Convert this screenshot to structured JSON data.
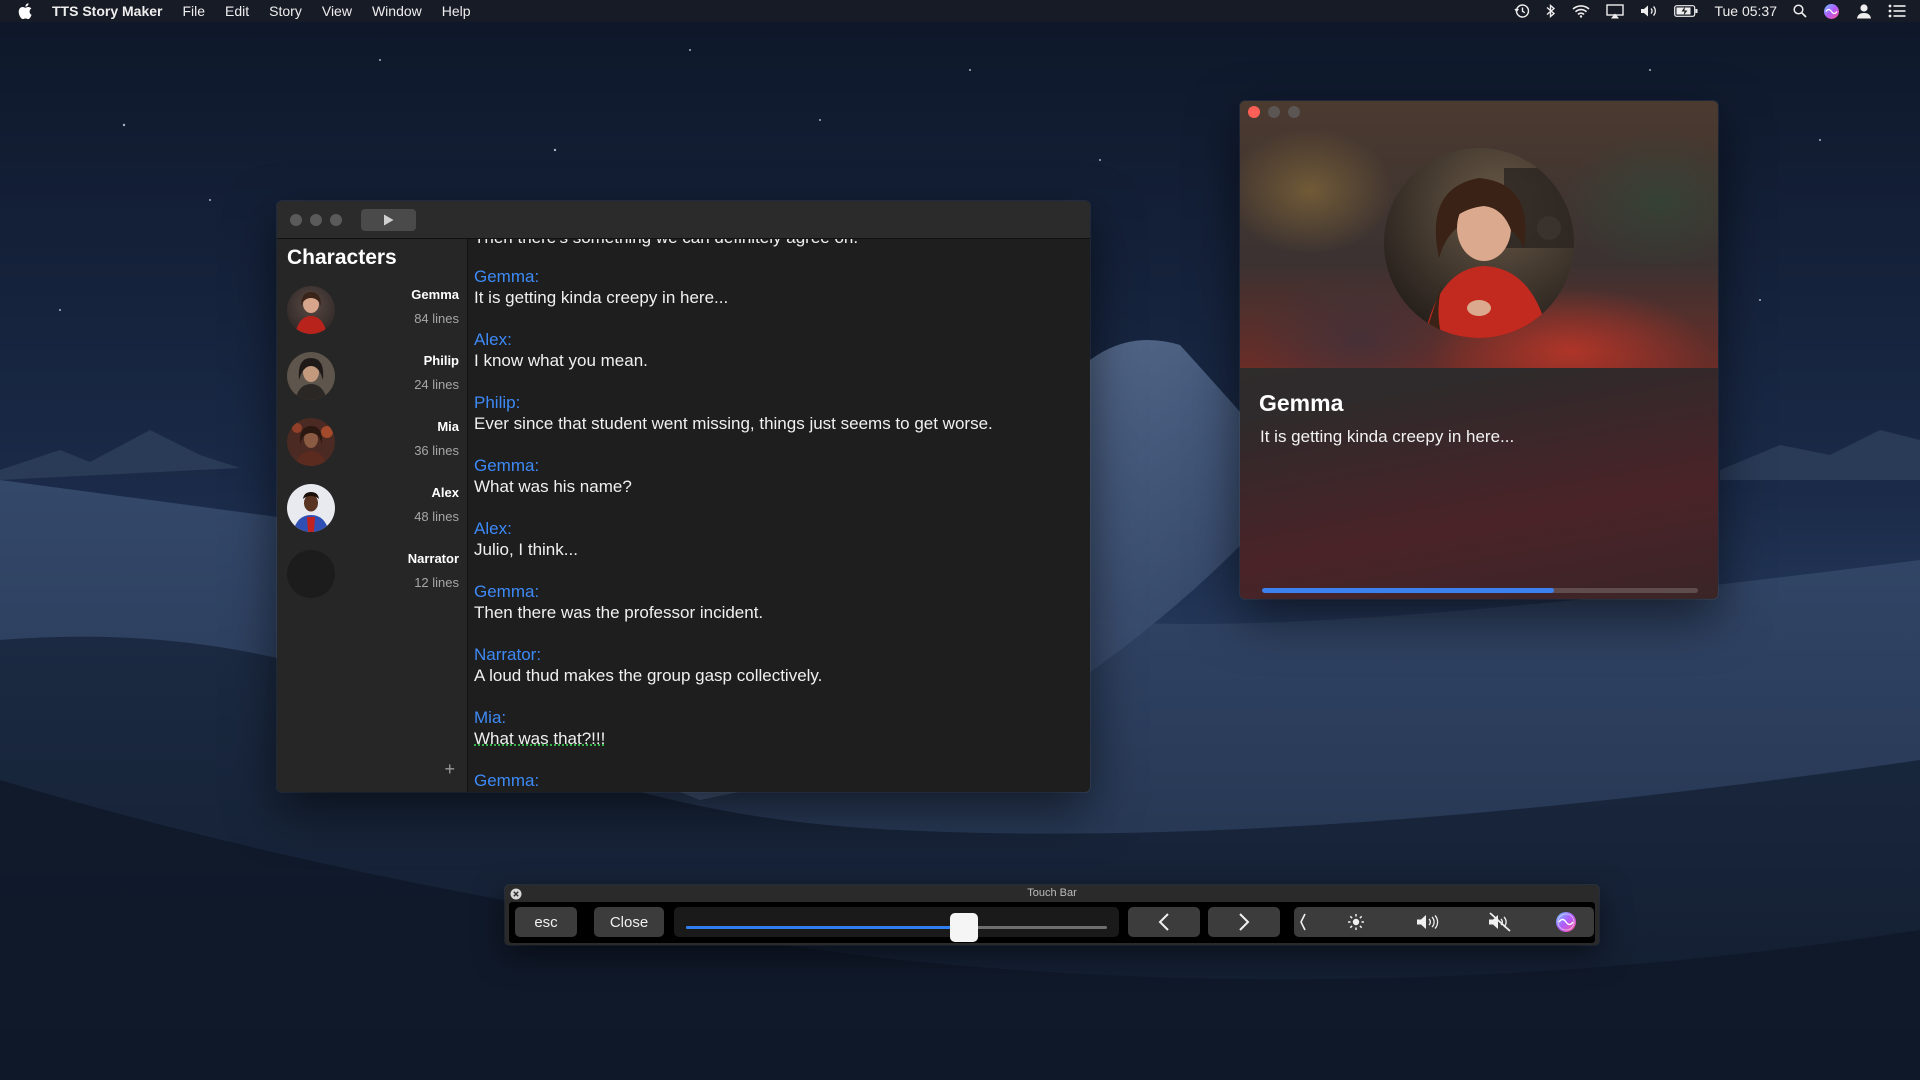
{
  "menubar": {
    "app_name": "TTS Story Maker",
    "menus": [
      "File",
      "Edit",
      "Story",
      "View",
      "Window",
      "Help"
    ],
    "clock": "Tue 05:37",
    "status_icons": [
      "time-machine-icon",
      "bluetooth-icon",
      "wifi-icon",
      "airplay-icon",
      "volume-icon",
      "battery-icon",
      "spotlight-icon",
      "siri-icon",
      "user-icon",
      "notification-center-icon"
    ]
  },
  "story_window": {
    "sidebar_title": "Characters",
    "characters": [
      {
        "name": "Gemma",
        "lines": "84 lines",
        "avatar_color": "#8a2a22"
      },
      {
        "name": "Philip",
        "lines": "24 lines",
        "avatar_color": "#5a4a3c"
      },
      {
        "name": "Mia",
        "lines": "36 lines",
        "avatar_color": "#6b2e20"
      },
      {
        "name": "Alex",
        "lines": "48 lines",
        "avatar_color": "#3a57b8"
      },
      {
        "name": "Narrator",
        "lines": "12 lines",
        "avatar_color": "#1c1c1c"
      }
    ],
    "add_label": "+",
    "cutoff_text": "Then there's something we can definitely agree on.",
    "script": [
      {
        "speaker": "Gemma:",
        "text": "It is getting kinda creepy in here..."
      },
      {
        "speaker": "Alex:",
        "text": "I know what you mean."
      },
      {
        "speaker": "Philip:",
        "text": "Ever since that student went missing, things just seems to get worse."
      },
      {
        "speaker": "Gemma:",
        "text": "What was his name?"
      },
      {
        "speaker": "Alex:",
        "text": "Julio, I think..."
      },
      {
        "speaker": "Gemma:",
        "text": "Then there was the professor incident."
      },
      {
        "speaker": "Narrator:",
        "text": "A loud thud makes the group gasp collectively."
      },
      {
        "speaker": "Mia:",
        "text": "What was that?!!!"
      },
      {
        "speaker": "Gemma:",
        "text": ""
      }
    ],
    "accent_color": "#3d8af7"
  },
  "now_playing": {
    "name": "Gemma",
    "text": "It is getting kinda creepy in here...",
    "progress": 0.67,
    "accent_color": "#3b82f0"
  },
  "touch_bar": {
    "title": "Touch Bar",
    "esc_label": "esc",
    "close_label": "Close",
    "slider_value": 0.66,
    "control_strip_icons": [
      "collapse-icon",
      "brightness-icon",
      "volume-icon",
      "mute-icon",
      "siri-icon"
    ]
  }
}
